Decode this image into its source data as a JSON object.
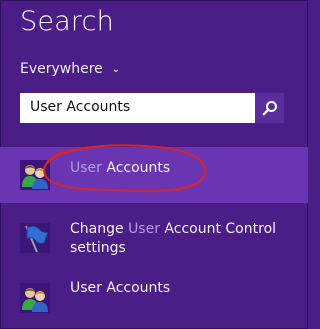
{
  "header": {
    "title": "Search"
  },
  "scope": {
    "label": "Everywhere"
  },
  "search": {
    "value": "User Accounts"
  },
  "results": [
    {
      "highlight": "User",
      "rest": " Accounts",
      "icon": "user-accounts-icon",
      "selected": true
    },
    {
      "pre": "Change ",
      "highlight": "User",
      "rest": " Account Control",
      "line2": "settings",
      "icon": "uac-flag-icon",
      "selected": false
    },
    {
      "label": "User Accounts",
      "icon": "user-accounts-icon",
      "selected": false
    }
  ],
  "colors": {
    "background": "#4a1e86",
    "selected_row": "#6a35b2",
    "match_highlight": "#b99be6",
    "annotation": "#d6252a"
  }
}
